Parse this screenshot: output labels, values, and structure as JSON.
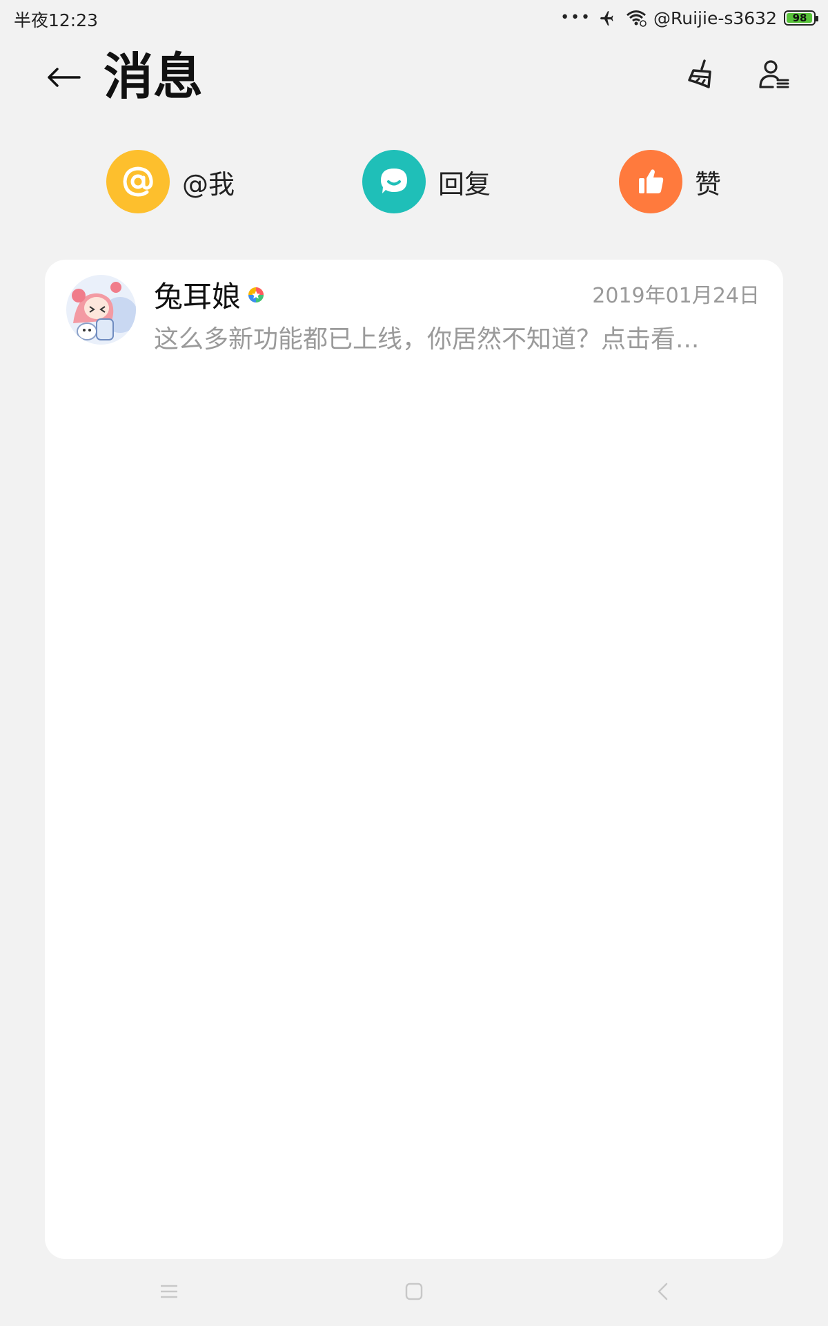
{
  "status_bar": {
    "time": "半夜12:23",
    "dots": "•••",
    "network": "@Ruijie-s3632",
    "battery_level": "98",
    "battery_fraction": 0.98
  },
  "header": {
    "title": "消息",
    "back_icon": "arrow-left-icon",
    "clean_icon": "broom-icon",
    "contacts_icon": "person-list-icon"
  },
  "categories": [
    {
      "label": "@我",
      "icon": "at-icon",
      "color": "#fdbf2d"
    },
    {
      "label": "回复",
      "icon": "chat-bubble-icon",
      "color": "#1fbfb8"
    },
    {
      "label": "赞",
      "icon": "thumbs-up-icon",
      "color": "#ff7a3d"
    }
  ],
  "messages": [
    {
      "sender": "兔耳娘",
      "date": "2019年01月24日",
      "preview": "这么多新功能都已上线，你居然不知道？点击看..."
    }
  ],
  "nav": {
    "menu_icon": "menu-icon",
    "home_icon": "home-square-icon",
    "back_icon": "back-chevron-icon"
  },
  "colors": {
    "background": "#f2f2f2",
    "card": "#ffffff",
    "at": "#fdbf2d",
    "reply": "#1fbfb8",
    "like": "#ff7a3d",
    "battery": "#57c23a"
  }
}
